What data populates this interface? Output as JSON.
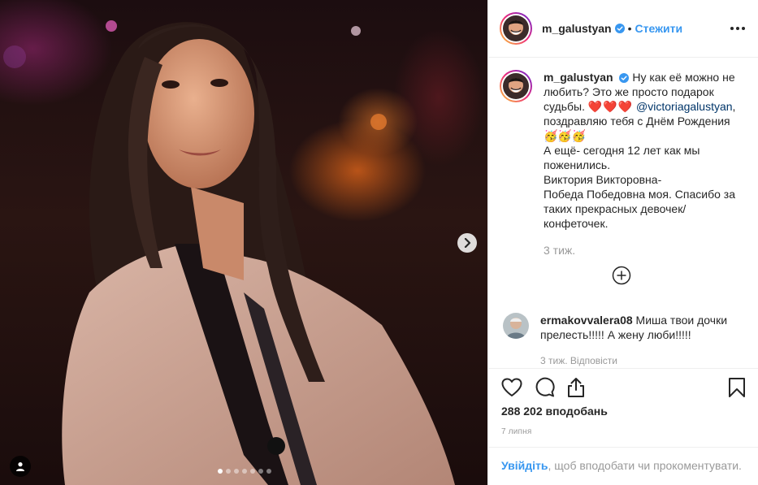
{
  "post": {
    "author": "m_galustyan",
    "verified": true,
    "follow_label": "Стежити",
    "separator": "•",
    "more_icon": "more-horizontal-icon"
  },
  "media": {
    "carousel_total": 7,
    "carousel_active": 1,
    "next_icon": "chevron-right-icon",
    "tag_icon": "user-tag-icon"
  },
  "caption": {
    "username": "m_galustyan",
    "line1": "Ну как её можно не любить? Это же просто подарок судьбы.",
    "hearts": "❤️❤️❤️",
    "mention": "@victoriagalustyan",
    "line2": ", поздравляю тебя с Днём Рождения",
    "emoji": "🥳🥳🥳",
    "line3": "А ещё- сегодня 12 лет как мы поженились.",
    "line4": "Виктория Викторовна-",
    "line5": "Победа Победовна моя. Спасибо за таких прекрасных девочек/конфеточек.",
    "time": "3 тиж."
  },
  "load_more_icon": "plus-circle-icon",
  "comments": [
    {
      "username": "ermakovvalera08",
      "text": "Миша твои дочки прелесть!!!!! А жену люби!!!!!",
      "meta": "3 тиж.  Відповісти"
    }
  ],
  "actions": {
    "like_icon": "heart-icon",
    "comment_icon": "comment-icon",
    "share_icon": "share-icon",
    "save_icon": "bookmark-icon",
    "likes": "288 202 вподобань",
    "date": "7 липня"
  },
  "login": {
    "link": "Увійдіть",
    "text": ", щоб вподобати чи прокоментувати."
  },
  "colors": {
    "accent": "#3897f0",
    "mention": "#003569",
    "text": "#262626",
    "muted": "#999999",
    "border": "#efefef"
  }
}
